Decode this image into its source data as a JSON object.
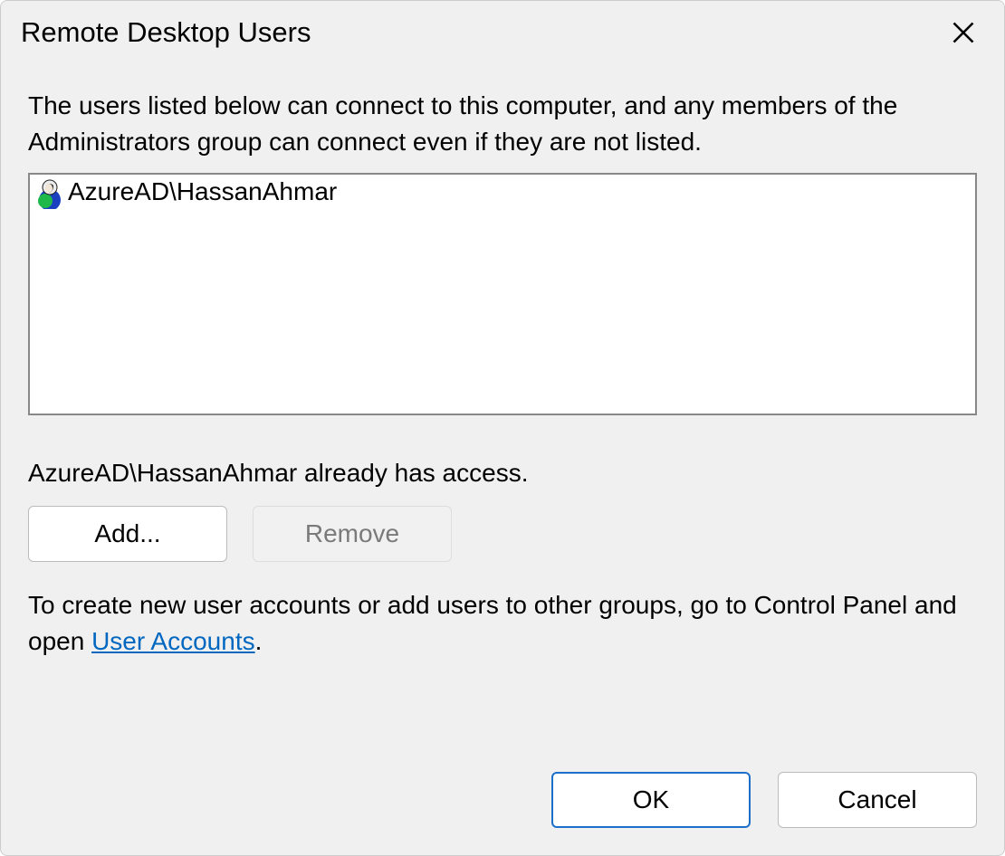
{
  "dialog": {
    "title": "Remote Desktop Users",
    "description": "The users listed below can connect to this computer, and any members of the Administrators group can connect even if they are not listed.",
    "users": [
      {
        "name": "AzureAD\\HassanAhmar",
        "icon": "user-icon"
      }
    ],
    "status": "AzureAD\\HassanAhmar already has access.",
    "buttons": {
      "add": "Add...",
      "remove": "Remove"
    },
    "help_prefix": "To create new user accounts or add users to other groups, go to Control Panel and open ",
    "help_link": "User Accounts",
    "help_suffix": ".",
    "footer": {
      "ok": "OK",
      "cancel": "Cancel"
    }
  }
}
